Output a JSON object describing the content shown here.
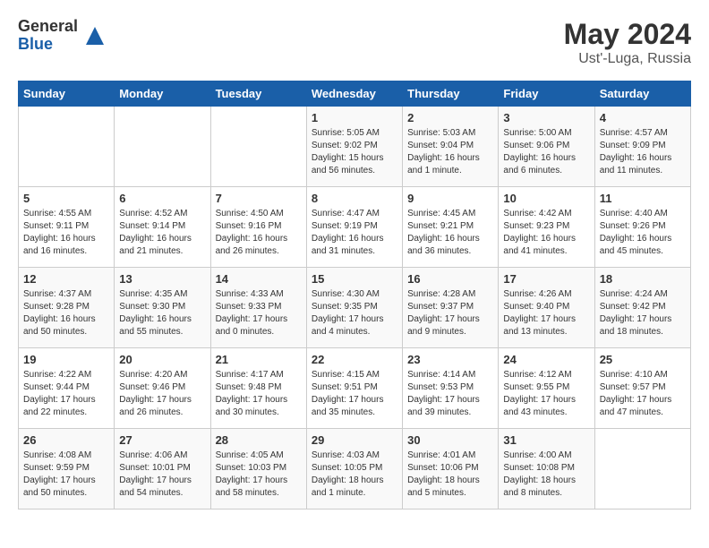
{
  "logo": {
    "general": "General",
    "blue": "Blue"
  },
  "title": "May 2024",
  "location": "Ust'-Luga, Russia",
  "days_of_week": [
    "Sunday",
    "Monday",
    "Tuesday",
    "Wednesday",
    "Thursday",
    "Friday",
    "Saturday"
  ],
  "weeks": [
    [
      {
        "day": "",
        "info": ""
      },
      {
        "day": "",
        "info": ""
      },
      {
        "day": "",
        "info": ""
      },
      {
        "day": "1",
        "info": "Sunrise: 5:05 AM\nSunset: 9:02 PM\nDaylight: 15 hours\nand 56 minutes."
      },
      {
        "day": "2",
        "info": "Sunrise: 5:03 AM\nSunset: 9:04 PM\nDaylight: 16 hours\nand 1 minute."
      },
      {
        "day": "3",
        "info": "Sunrise: 5:00 AM\nSunset: 9:06 PM\nDaylight: 16 hours\nand 6 minutes."
      },
      {
        "day": "4",
        "info": "Sunrise: 4:57 AM\nSunset: 9:09 PM\nDaylight: 16 hours\nand 11 minutes."
      }
    ],
    [
      {
        "day": "5",
        "info": "Sunrise: 4:55 AM\nSunset: 9:11 PM\nDaylight: 16 hours\nand 16 minutes."
      },
      {
        "day": "6",
        "info": "Sunrise: 4:52 AM\nSunset: 9:14 PM\nDaylight: 16 hours\nand 21 minutes."
      },
      {
        "day": "7",
        "info": "Sunrise: 4:50 AM\nSunset: 9:16 PM\nDaylight: 16 hours\nand 26 minutes."
      },
      {
        "day": "8",
        "info": "Sunrise: 4:47 AM\nSunset: 9:19 PM\nDaylight: 16 hours\nand 31 minutes."
      },
      {
        "day": "9",
        "info": "Sunrise: 4:45 AM\nSunset: 9:21 PM\nDaylight: 16 hours\nand 36 minutes."
      },
      {
        "day": "10",
        "info": "Sunrise: 4:42 AM\nSunset: 9:23 PM\nDaylight: 16 hours\nand 41 minutes."
      },
      {
        "day": "11",
        "info": "Sunrise: 4:40 AM\nSunset: 9:26 PM\nDaylight: 16 hours\nand 45 minutes."
      }
    ],
    [
      {
        "day": "12",
        "info": "Sunrise: 4:37 AM\nSunset: 9:28 PM\nDaylight: 16 hours\nand 50 minutes."
      },
      {
        "day": "13",
        "info": "Sunrise: 4:35 AM\nSunset: 9:30 PM\nDaylight: 16 hours\nand 55 minutes."
      },
      {
        "day": "14",
        "info": "Sunrise: 4:33 AM\nSunset: 9:33 PM\nDaylight: 17 hours\nand 0 minutes."
      },
      {
        "day": "15",
        "info": "Sunrise: 4:30 AM\nSunset: 9:35 PM\nDaylight: 17 hours\nand 4 minutes."
      },
      {
        "day": "16",
        "info": "Sunrise: 4:28 AM\nSunset: 9:37 PM\nDaylight: 17 hours\nand 9 minutes."
      },
      {
        "day": "17",
        "info": "Sunrise: 4:26 AM\nSunset: 9:40 PM\nDaylight: 17 hours\nand 13 minutes."
      },
      {
        "day": "18",
        "info": "Sunrise: 4:24 AM\nSunset: 9:42 PM\nDaylight: 17 hours\nand 18 minutes."
      }
    ],
    [
      {
        "day": "19",
        "info": "Sunrise: 4:22 AM\nSunset: 9:44 PM\nDaylight: 17 hours\nand 22 minutes."
      },
      {
        "day": "20",
        "info": "Sunrise: 4:20 AM\nSunset: 9:46 PM\nDaylight: 17 hours\nand 26 minutes."
      },
      {
        "day": "21",
        "info": "Sunrise: 4:17 AM\nSunset: 9:48 PM\nDaylight: 17 hours\nand 30 minutes."
      },
      {
        "day": "22",
        "info": "Sunrise: 4:15 AM\nSunset: 9:51 PM\nDaylight: 17 hours\nand 35 minutes."
      },
      {
        "day": "23",
        "info": "Sunrise: 4:14 AM\nSunset: 9:53 PM\nDaylight: 17 hours\nand 39 minutes."
      },
      {
        "day": "24",
        "info": "Sunrise: 4:12 AM\nSunset: 9:55 PM\nDaylight: 17 hours\nand 43 minutes."
      },
      {
        "day": "25",
        "info": "Sunrise: 4:10 AM\nSunset: 9:57 PM\nDaylight: 17 hours\nand 47 minutes."
      }
    ],
    [
      {
        "day": "26",
        "info": "Sunrise: 4:08 AM\nSunset: 9:59 PM\nDaylight: 17 hours\nand 50 minutes."
      },
      {
        "day": "27",
        "info": "Sunrise: 4:06 AM\nSunset: 10:01 PM\nDaylight: 17 hours\nand 54 minutes."
      },
      {
        "day": "28",
        "info": "Sunrise: 4:05 AM\nSunset: 10:03 PM\nDaylight: 17 hours\nand 58 minutes."
      },
      {
        "day": "29",
        "info": "Sunrise: 4:03 AM\nSunset: 10:05 PM\nDaylight: 18 hours\nand 1 minute."
      },
      {
        "day": "30",
        "info": "Sunrise: 4:01 AM\nSunset: 10:06 PM\nDaylight: 18 hours\nand 5 minutes."
      },
      {
        "day": "31",
        "info": "Sunrise: 4:00 AM\nSunset: 10:08 PM\nDaylight: 18 hours\nand 8 minutes."
      },
      {
        "day": "",
        "info": ""
      }
    ]
  ]
}
